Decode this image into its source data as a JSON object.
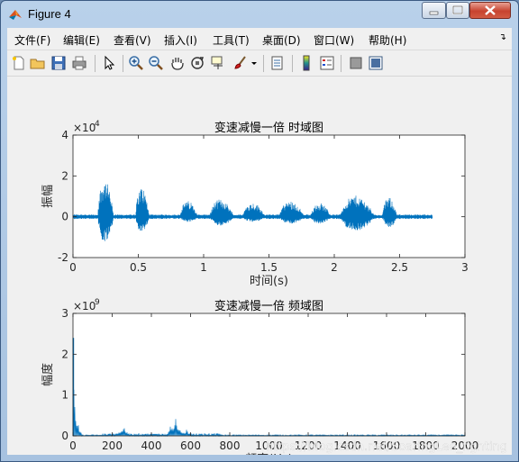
{
  "window": {
    "title": "Figure 4"
  },
  "menu": {
    "items": [
      "文件(F)",
      "编辑(E)",
      "查看(V)",
      "插入(I)",
      "工具(T)",
      "桌面(D)",
      "窗口(W)",
      "帮助(H)"
    ]
  },
  "toolbar": {
    "icons": [
      "new-figure-icon",
      "open-file-icon",
      "save-icon",
      "print-icon",
      "pointer-icon",
      "zoom-in-icon",
      "zoom-out-icon",
      "pan-hand-icon",
      "rotate-3d-icon",
      "data-cursor-icon",
      "brush-icon",
      "brush-dropdown-icon",
      "link-plot-icon",
      "colorbar-icon",
      "legend-icon",
      "hide-plot-tools-icon",
      "show-plot-tools-icon"
    ]
  },
  "chart_data": [
    {
      "type": "line",
      "title": "变速减慢一倍 时域图",
      "xlabel": "时间(s)",
      "ylabel": "振幅",
      "exponent_label": "×10",
      "exponent_power": "4",
      "xlim": [
        0,
        3
      ],
      "ylim": [
        -20000,
        40000
      ],
      "x_ticks": [
        "0",
        "0.5",
        "1",
        "1.5",
        "2",
        "2.5",
        "3"
      ],
      "y_ticks": [
        "-2",
        "0",
        "2",
        "4"
      ],
      "color": "#0072bd",
      "signal_end": 2.75,
      "bursts": [
        {
          "start": 0.19,
          "end": 0.33,
          "peak_pos": 21000,
          "peak_neg": -15000
        },
        {
          "start": 0.48,
          "end": 0.6,
          "peak_pos": 17000,
          "peak_neg": -9000
        },
        {
          "start": 0.82,
          "end": 0.98,
          "peak_pos": 9000,
          "peak_neg": -3000
        },
        {
          "start": 1.05,
          "end": 1.26,
          "peak_pos": 10000,
          "peak_neg": -5000
        },
        {
          "start": 1.3,
          "end": 1.5,
          "peak_pos": 8000,
          "peak_neg": -3000
        },
        {
          "start": 1.58,
          "end": 1.8,
          "peak_pos": 9000,
          "peak_neg": -4000
        },
        {
          "start": 1.82,
          "end": 2.0,
          "peak_pos": 8000,
          "peak_neg": -4000
        },
        {
          "start": 2.05,
          "end": 2.35,
          "peak_pos": 12000,
          "peak_neg": -8000
        },
        {
          "start": 2.37,
          "end": 2.5,
          "peak_pos": 11000,
          "peak_neg": -6000
        }
      ]
    },
    {
      "type": "line",
      "title": "变速减慢一倍 频域图",
      "xlabel": "频率(Hz)",
      "ylabel": "幅度",
      "exponent_label": "×10",
      "exponent_power": "9",
      "xlim": [
        0,
        2000
      ],
      "ylim": [
        0,
        3000000000.0
      ],
      "x_ticks": [
        "0",
        "200",
        "400",
        "600",
        "800",
        "1000",
        "1200",
        "1400",
        "1600",
        "1800",
        "2000"
      ],
      "y_ticks": [
        "0",
        "1",
        "2",
        "3"
      ],
      "color": "#0072bd",
      "peaks": [
        {
          "x": 2,
          "y": 2400000000.0
        },
        {
          "x": 8,
          "y": 600000000.0
        },
        {
          "x": 248,
          "y": 180000000.0
        },
        {
          "x": 262,
          "y": 250000000.0
        },
        {
          "x": 500,
          "y": 300000000.0
        },
        {
          "x": 520,
          "y": 550000000.0
        },
        {
          "x": 540,
          "y": 300000000.0
        },
        {
          "x": 580,
          "y": 150000000.0
        }
      ]
    }
  ],
  "watermark": "https://blog.csdn.net/SoaringLee_fighting"
}
